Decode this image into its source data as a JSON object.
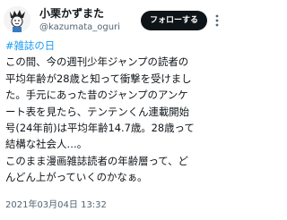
{
  "author": {
    "display_name": "小栗かずまた",
    "handle": "@kazumata_oguri"
  },
  "actions": {
    "follow_label": "フォローする",
    "more_icon": "more-icon"
  },
  "tweet": {
    "hashtag": "#雑誌の日",
    "lines": [
      "この間、今の週刊少年ジャンプの読者の",
      "平均年齢が28歳と知って衝撃を受けまし",
      "た。手元にあった昔のジャンプのアンケ",
      "ート表を見たら、テンテンくん連載開始",
      "号(24年前)は平均年齢14.7歳。28歳って",
      "結構な社会人…。",
      "このまま漫画雑誌読者の年齢層って、ど",
      "んどん上がっていくのかなぁ。"
    ],
    "timestamp": "2021年03月04日 13:32"
  },
  "colors": {
    "hashtag": "#1d9bf0",
    "follow_bg": "#0f1419"
  }
}
